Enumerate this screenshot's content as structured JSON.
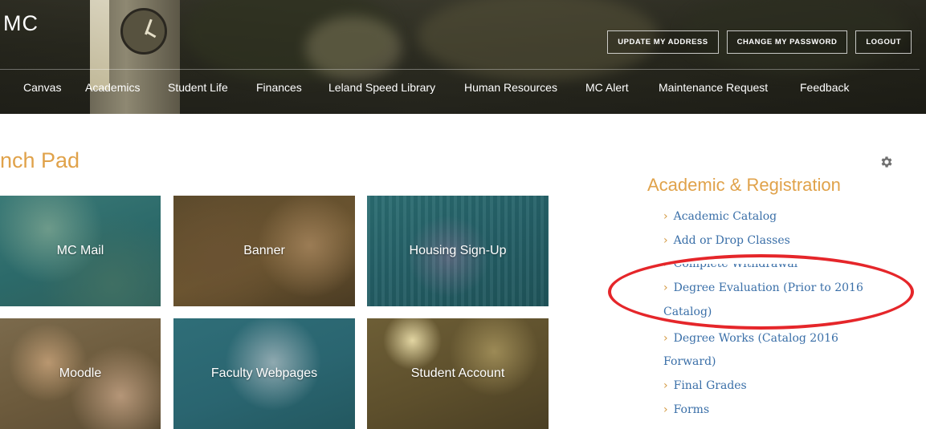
{
  "header": {
    "logo_text": "MC",
    "buttons": [
      "UPDATE MY ADDRESS",
      "CHANGE MY PASSWORD",
      "LOGOUT"
    ],
    "nav": [
      "Canvas",
      "Academics",
      "Student Life",
      "Finances",
      "Leland Speed Library",
      "Human Resources",
      "MC Alert",
      "Maintenance Request",
      "Feedback"
    ]
  },
  "launchpad": {
    "title": "nch Pad",
    "tiles": [
      "MC Mail",
      "Banner",
      "Housing Sign-Up",
      "Moodle",
      "Faculty Webpages",
      "Student Account"
    ]
  },
  "sidebar": {
    "title": "Academic & Registration",
    "links": [
      {
        "line1": "Academic Catalog"
      },
      {
        "line1": "Add or Drop Classes"
      },
      {
        "line1": "Complete Withdrawal"
      },
      {
        "line1": "Degree Evaluation (Prior to 2016",
        "line2": "Catalog)"
      },
      {
        "line1": "Degree Works (Catalog 2016",
        "line2": "Forward)"
      },
      {
        "line1": "Final Grades"
      },
      {
        "line1": "Forms"
      }
    ]
  },
  "colors": {
    "accent": "#e0a24a",
    "link": "#3a6fa8",
    "annotation": "#e5262a"
  },
  "icons": {
    "settings": "gear-icon",
    "bullet": "chevron-right-icon"
  }
}
